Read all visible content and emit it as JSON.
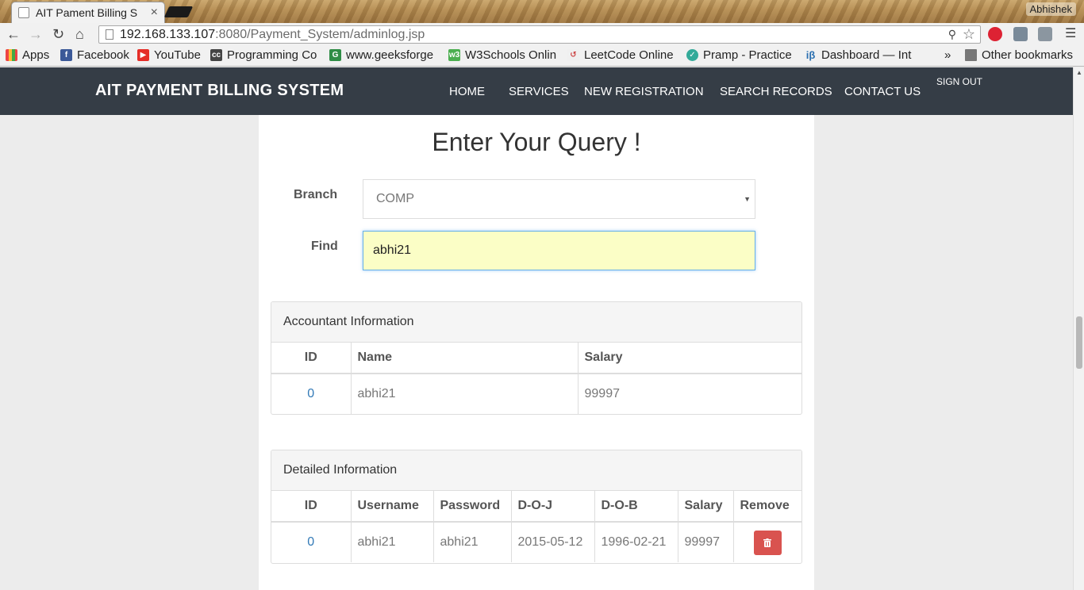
{
  "browser": {
    "tab_title": "AIT Pament Billing S",
    "tab_close": "×",
    "profile_name": "Abhishek",
    "url_host": "192.168.133.107",
    "url_rest": ":8080/Payment_System/adminlog.jsp",
    "bookmarks": [
      {
        "label": "Apps",
        "icon": "apps-grid-icon"
      },
      {
        "label": "Facebook",
        "icon": "facebook-icon"
      },
      {
        "label": "YouTube",
        "icon": "youtube-icon"
      },
      {
        "label": "Programming Co",
        "icon": "cc-icon"
      },
      {
        "label": "www.geeksforge",
        "icon": "geeksforgeeks-icon"
      },
      {
        "label": "W3Schools Onlin",
        "icon": "w3schools-icon"
      },
      {
        "label": "LeetCode Online",
        "icon": "leetcode-icon"
      },
      {
        "label": "Pramp - Practice",
        "icon": "pramp-icon"
      },
      {
        "label": "Dashboard — Int",
        "icon": "interviewbit-icon"
      }
    ],
    "more_bookmarks": "»",
    "other_bookmarks": "Other bookmarks"
  },
  "nav": {
    "brand": "AIT PAYMENT BILLING SYSTEM",
    "items": [
      "HOME",
      "SERVICES",
      "NEW REGISTRATION",
      "SEARCH RECORDS",
      "CONTACT US"
    ],
    "signout": "SIGN OUT"
  },
  "query": {
    "heading": "Enter Your Query !",
    "branch_label": "Branch",
    "branch_value": "COMP",
    "find_label": "Find",
    "find_value": "abhi21"
  },
  "accountant": {
    "title": "Accountant Information",
    "headers": [
      "ID",
      "Name",
      "Salary"
    ],
    "row": {
      "id": "0",
      "name": "abhi21",
      "salary": "99997"
    }
  },
  "detailed": {
    "title": "Detailed Information",
    "headers": [
      "ID",
      "Username",
      "Password",
      "D-O-J",
      "D-O-B",
      "Salary",
      "Remove"
    ],
    "row": {
      "id": "0",
      "username": "abhi21",
      "password": "abhi21",
      "doj": "2015-05-12",
      "dob": "1996-02-21",
      "salary": "99997"
    }
  },
  "colors": {
    "navbar": "#353d46",
    "link": "#337ab7",
    "danger": "#d9534f",
    "input_focus_bg": "#fbfec6"
  }
}
